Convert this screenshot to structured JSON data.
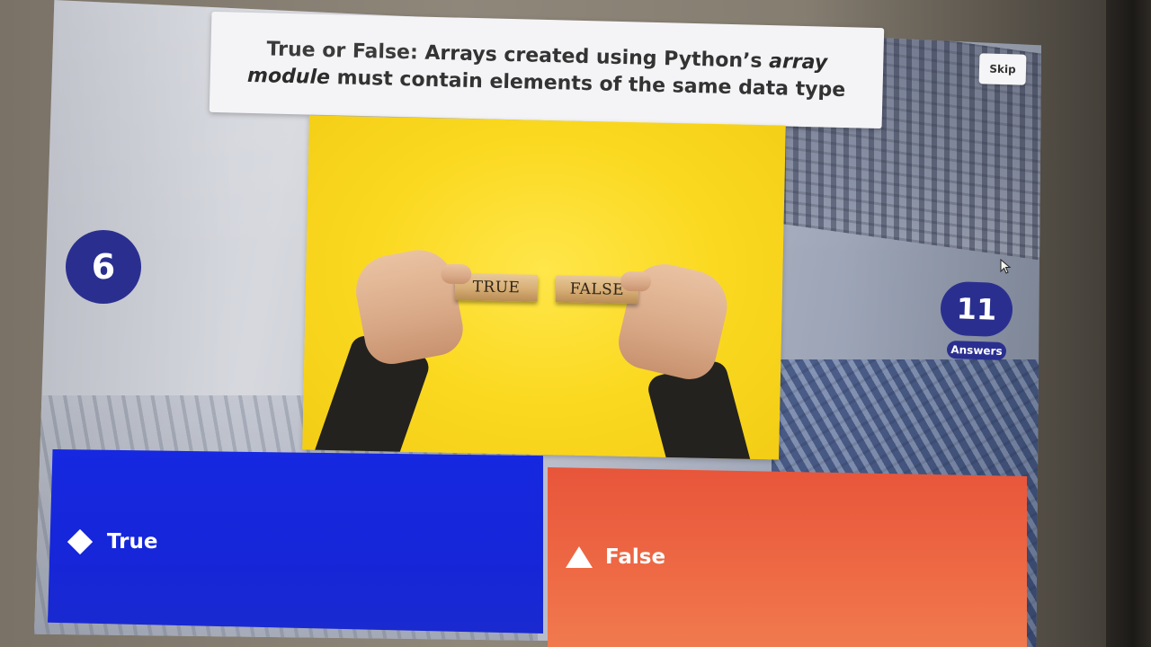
{
  "question": {
    "lead": "True or False:",
    "text_before": " Arrays created using Python’s ",
    "emphasis": "array module",
    "text_after": " must contain elements of the same data type"
  },
  "controls": {
    "skip_label": "Skip"
  },
  "timer": {
    "value": "6"
  },
  "answers_counter": {
    "count": "11",
    "label": "Answers"
  },
  "media": {
    "block_left_text": "TRUE",
    "block_right_text": "FALSE"
  },
  "options": [
    {
      "label": "True",
      "shape": "diamond-icon",
      "color": "#1628e0"
    },
    {
      "label": "False",
      "shape": "triangle-icon",
      "color": "#ee6a45"
    }
  ],
  "colors": {
    "accent_navy": "#2a2f8f",
    "option_blue": "#1628e0",
    "option_orange": "#ee6a45",
    "media_yellow": "#fbd921"
  }
}
